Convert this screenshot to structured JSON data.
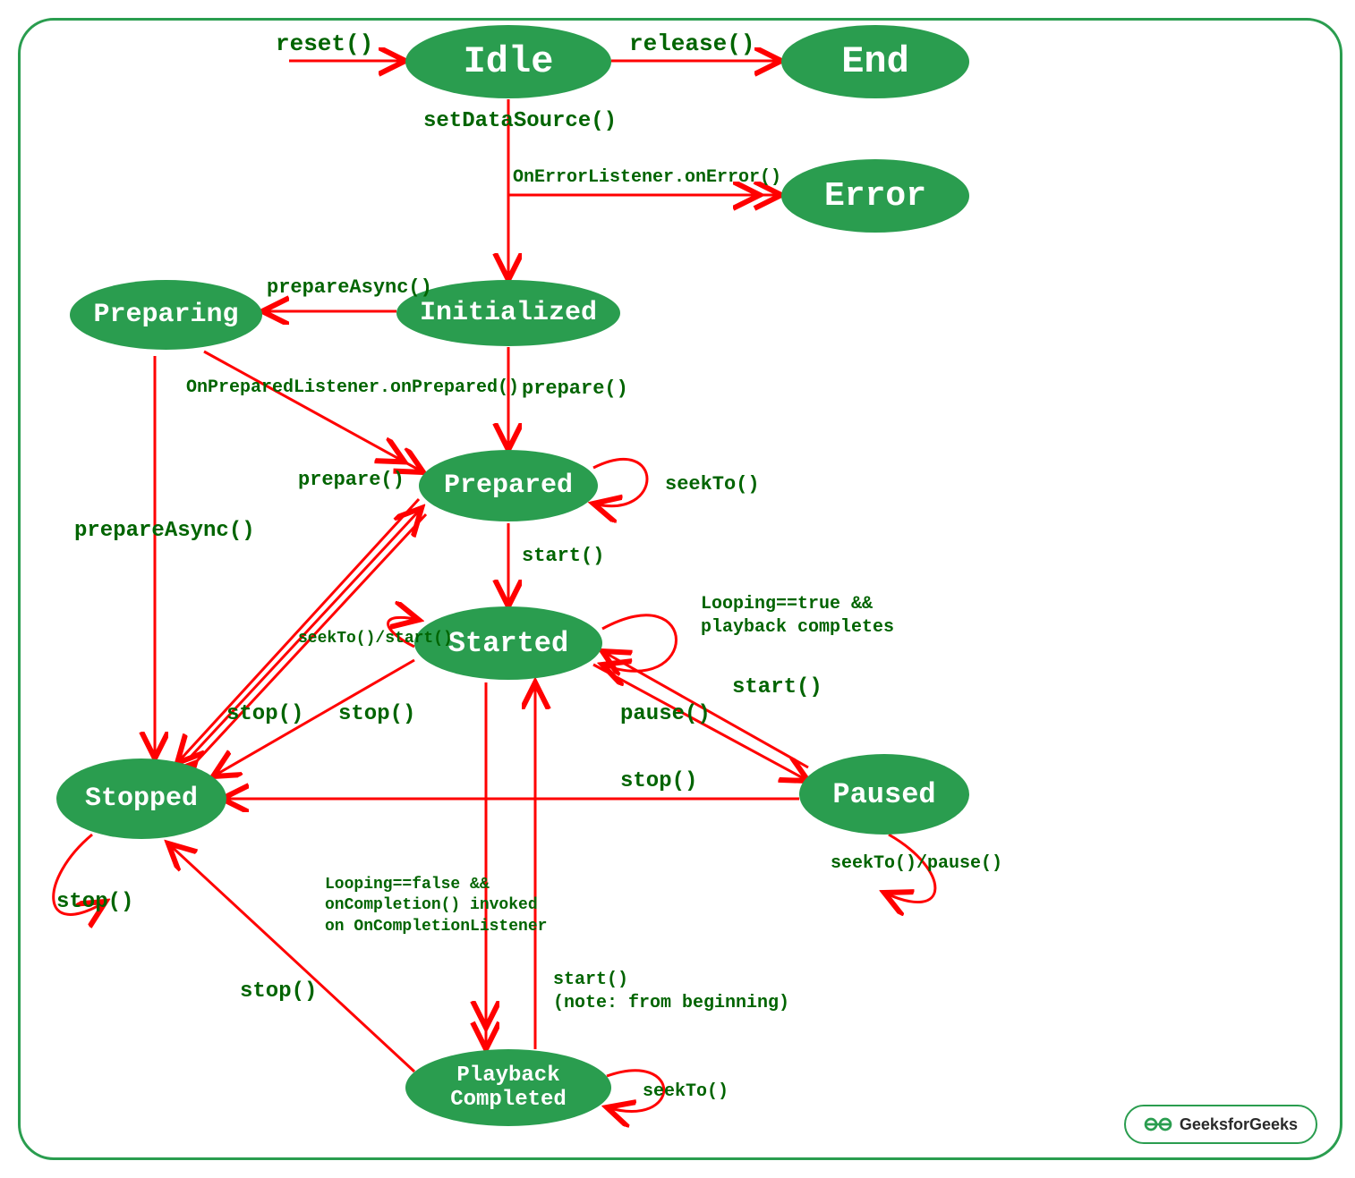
{
  "states": {
    "idle": "Idle",
    "end": "End",
    "error": "Error",
    "initialized": "Initialized",
    "preparing": "Preparing",
    "prepared": "Prepared",
    "started": "Started",
    "stopped": "Stopped",
    "paused": "Paused",
    "playbackCompleted": "Playback\nCompleted"
  },
  "edges": {
    "reset": "reset()",
    "release": "release()",
    "setDataSource": "setDataSource()",
    "onError": "OnErrorListener.onError()",
    "prepareAsync1": "prepareAsync()",
    "onPrepared": "OnPreparedListener.onPrepared()",
    "prepare1": "prepare()",
    "prepareAsync2": "prepareAsync()",
    "prepare2": "prepare()",
    "seekToPrepared": "seekTo()",
    "start1": "start()",
    "seekToStart": "seekTo()/start()",
    "loopingTrue": "Looping==true &&\nplayback completes",
    "stop1": "stop()",
    "stop2": "stop()",
    "pause": "pause()",
    "startFromPaused": "start()",
    "stopFromPaused": "stop()",
    "stopSelf": "stop()",
    "seekToPause": "seekTo()/pause()",
    "loopingFalse": "Looping==false &&\nonCompletion() invoked\non OnCompletionListener",
    "stopFromCompleted": "stop()",
    "startFromCompleted": "start()\n(note: from beginning)",
    "seekToCompleted": "seekTo()"
  },
  "watermark": "GeeksforGeeks"
}
